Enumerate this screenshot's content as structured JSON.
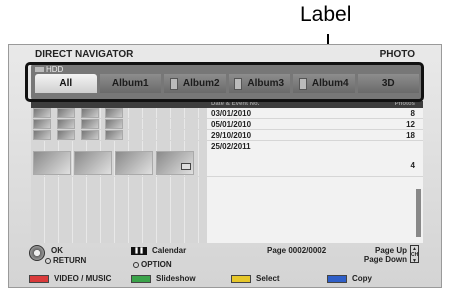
{
  "callout": {
    "label": "Label"
  },
  "header": {
    "title": "DIRECT NAVIGATOR",
    "mode": "PHOTO"
  },
  "drive": "HDD",
  "tabs": [
    {
      "label": "All",
      "active": true
    },
    {
      "label": "Album1",
      "active": false
    },
    {
      "label": "Album2",
      "active": false
    },
    {
      "label": "Album3",
      "active": false
    },
    {
      "label": "Album4",
      "active": false
    },
    {
      "label": "3D",
      "active": false
    }
  ],
  "list_header": {
    "date_col": "Date & Event No.",
    "count_col": "Photos"
  },
  "rows": [
    {
      "date": "03/01/2010",
      "count": "8"
    },
    {
      "date": "05/01/2010",
      "count": "12"
    },
    {
      "date": "29/10/2010",
      "count": "18"
    },
    {
      "date": "25/02/2011",
      "count": "4"
    }
  ],
  "footer": {
    "ok": "OK",
    "return": "RETURN",
    "calendar": "Calendar",
    "option": "OPTION",
    "page": "Page 0002/0002",
    "page_up": "Page Up",
    "page_down": "Page Down",
    "ch": "CH"
  },
  "color_buttons": [
    {
      "label": "VIDEO / MUSIC",
      "color": "#d93a3a"
    },
    {
      "label": "Slideshow",
      "color": "#3aa34a"
    },
    {
      "label": "Select",
      "color": "#e6c72a"
    },
    {
      "label": "Copy",
      "color": "#2f5fc8"
    }
  ]
}
